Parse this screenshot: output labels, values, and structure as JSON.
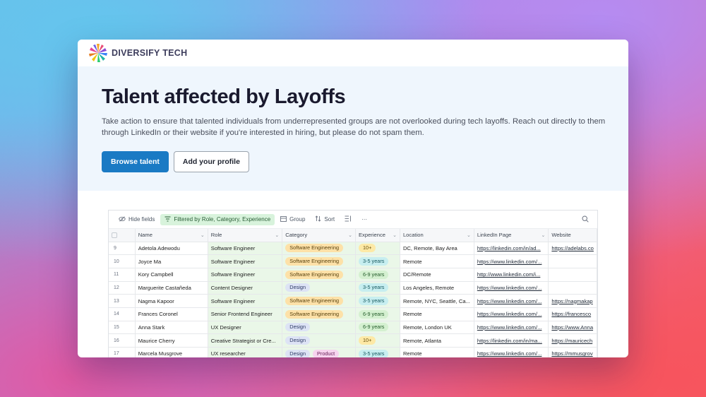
{
  "brand": {
    "name": "DIVERSIFY TECH"
  },
  "hero": {
    "title": "Talent affected by Layoffs",
    "description": "Take action to ensure that talented individuals from underrepresented groups are not overlooked during tech layoffs. Reach out directly to them through LinkedIn or their website if you're interested in hiring, but please do not spam them.",
    "primary_button": "Browse talent",
    "secondary_button": "Add your profile"
  },
  "toolbar": {
    "hide_fields": "Hide fields",
    "filter": "Filtered by Role, Category, Experience",
    "group": "Group",
    "sort": "Sort",
    "more": "···"
  },
  "columns": [
    "Name",
    "Role",
    "Category",
    "Experience",
    "Location",
    "LinkedIn Page",
    "Website"
  ],
  "rows": [
    {
      "num": "9",
      "name": "Adetola Adewodu",
      "role": "Software Engineer",
      "category": [
        "Software Engineering"
      ],
      "experience": "10+",
      "location": "DC, Remote, Bay Area",
      "linkedin": "https://linkedin.com/in/ad...",
      "website": "https://adelabs.co"
    },
    {
      "num": "10",
      "name": "Joyce Ma",
      "role": "Software Engineer",
      "category": [
        "Software Engineering"
      ],
      "experience": "3-5 years",
      "location": "Remote",
      "linkedin": "https://www.linkedin.com/...",
      "website": ""
    },
    {
      "num": "11",
      "name": "Kory Campbell",
      "role": "Software Engineer",
      "category": [
        "Software Engineering"
      ],
      "experience": "6-9 years",
      "location": "DC/Remote",
      "linkedin": "http://www.linkedin.com/i...",
      "website": ""
    },
    {
      "num": "12",
      "name": "Marguerite Castañeda",
      "role": "Content Designer",
      "category": [
        "Design"
      ],
      "experience": "3-5 years",
      "location": "Los Angeles, Remote",
      "linkedin": "https://www.linkedin.com/...",
      "website": ""
    },
    {
      "num": "13",
      "name": "Nagma Kapoor",
      "role": "Software Engineer",
      "category": [
        "Software Engineering"
      ],
      "experience": "3-5 years",
      "location": "Remote, NYC, Seattle, Ca...",
      "linkedin": "https://www.linkedin.com/...",
      "website": "https://nagmakap"
    },
    {
      "num": "14",
      "name": "Frances Coronel",
      "role": "Senior Frontend Engineer",
      "category": [
        "Software Engineering"
      ],
      "experience": "6-9 years",
      "location": "Remote",
      "linkedin": "https://www.linkedin.com/...",
      "website": "https://francesco"
    },
    {
      "num": "15",
      "name": "Anna Stark",
      "role": "UX Designer",
      "category": [
        "Design"
      ],
      "experience": "6-9 years",
      "location": "Remote, London UK",
      "linkedin": "https://www.linkedin.com/...",
      "website": "https://www.Anna"
    },
    {
      "num": "16",
      "name": "Maurice Cherry",
      "role": "Creative Strategist or Cre...",
      "category": [
        "Design"
      ],
      "experience": "10+",
      "location": "Remote, Atlanta",
      "linkedin": "https://linkedin.com/in/ma...",
      "website": "https://mauricech"
    },
    {
      "num": "17",
      "name": "Marcela Musgrove",
      "role": "UX researcher",
      "category": [
        "Design",
        "Product"
      ],
      "experience": "3-5 years",
      "location": "Remote",
      "linkedin": "https://www.linkedin.com/...",
      "website": "https://mmusgrov"
    }
  ],
  "colors": {
    "primary_button": "#1a7ac4",
    "hero_background": "#eff6fd",
    "filter_chip": "#d8f3dc",
    "filtered_column": "#eaf7e8"
  }
}
